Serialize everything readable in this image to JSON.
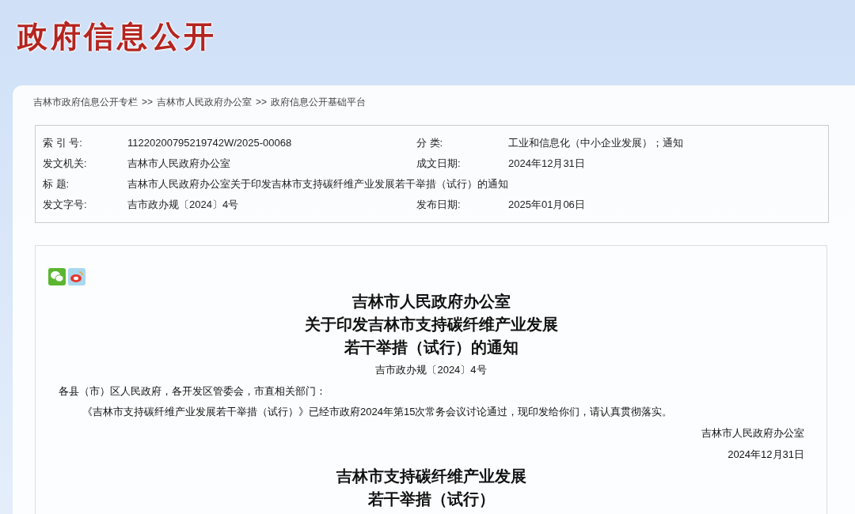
{
  "header": {
    "title": "政府信息公开"
  },
  "breadcrumb": [
    {
      "label": "吉林市政府信息公开专栏"
    },
    {
      "label": "吉林市人民政府办公室"
    },
    {
      "label": "政府信息公开基础平台"
    }
  ],
  "breadcrumb_separator": ">>",
  "meta": [
    {
      "label": "索 引 号:",
      "value": "11220200795219742W/2025-00068",
      "label2": "分 类:",
      "value2": "工业和信息化（中小企业发展）；通知"
    },
    {
      "label": "发文机关:",
      "value": "吉林市人民政府办公室",
      "label2": "成文日期:",
      "value2": "2024年12月31日"
    },
    {
      "label": "标 题:",
      "value": "吉林市人民政府办公室关于印发吉林市支持碳纤维产业发展若干举措（试行）的通知"
    },
    {
      "label": "发文字号:",
      "value": "吉市政办规〔2024〕4号",
      "label2": "发布日期:",
      "value2": "2025年01月06日"
    }
  ],
  "document": {
    "title_lines": [
      "吉林市人民政府办公室",
      "关于印发吉林市支持碳纤维产业发展",
      "若干举措（试行）的通知"
    ],
    "doc_number": "吉市政办规〔2024〕4号",
    "salutation": "各县（市）区人民政府，各开发区管委会，市直相关部门：",
    "body": "《吉林市支持碳纤维产业发展若干举措（试行）》已经市政府2024年第15次常务会议讨论通过，现印发给你们，请认真贯彻落实。",
    "signature": "吉林市人民政府办公室",
    "date": "2024年12月31日",
    "subtitle_lines": [
      "吉林市支持碳纤维产业发展",
      "若干举措（试行）"
    ]
  }
}
